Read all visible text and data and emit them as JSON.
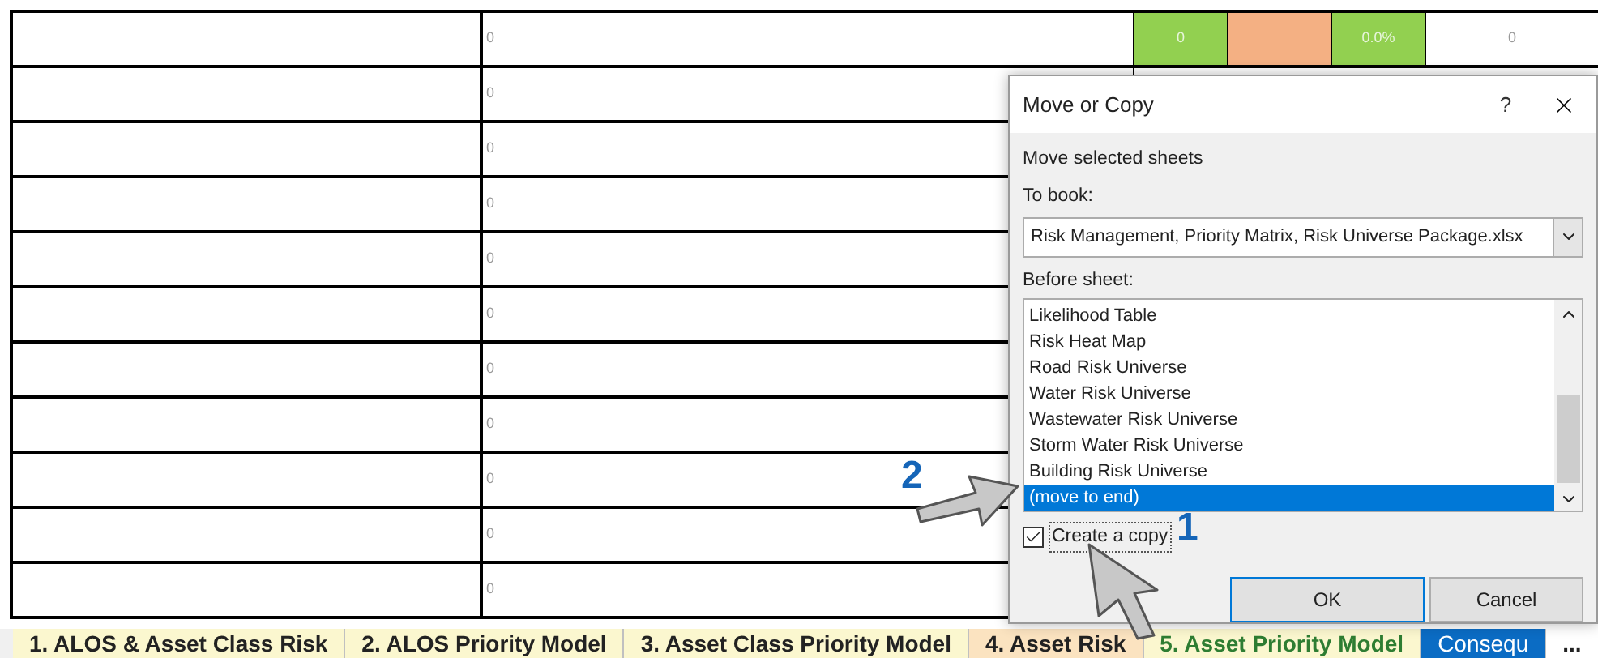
{
  "sheet": {
    "rows": [
      {
        "column_2": "0",
        "column_3": "0",
        "column_4": "",
        "column_5": "0.0%",
        "column_6": "0"
      },
      {
        "column_2": "0"
      },
      {
        "column_2": "0"
      },
      {
        "column_2": "0"
      },
      {
        "column_2": "0"
      },
      {
        "column_2": "0"
      },
      {
        "column_2": "0"
      },
      {
        "column_2": "0"
      },
      {
        "column_2": "0"
      },
      {
        "column_2": "0"
      },
      {
        "column_2": "0"
      }
    ]
  },
  "sheet_tabs": [
    {
      "label": "1. ALOS & Asset Class Risk",
      "selected": false,
      "color": "#fbf7cf"
    },
    {
      "label": "2. ALOS Priority Model",
      "selected": false,
      "color": "#fbf7cf"
    },
    {
      "label": "3. Asset Class Priority Model",
      "selected": false,
      "color": "#fbf7cf"
    },
    {
      "label": "4. Asset Risk",
      "selected": false,
      "color": "#fbe3c0"
    },
    {
      "label": "5. Asset Priority Model",
      "selected": false,
      "color": "#fbf7cf"
    },
    {
      "label": "Consequ",
      "selected": true,
      "color": "#0b6cc4"
    },
    {
      "label": "...",
      "selected": false,
      "color": "#ffffff"
    }
  ],
  "dialog": {
    "title": "Move or Copy",
    "help": "?",
    "intro": "Move selected sheets",
    "to_book_label": "To book:",
    "to_book_value": "Risk Management, Priority Matrix, Risk Universe Package.xlsx",
    "before_sheet_label": "Before sheet:",
    "sheets": [
      {
        "label": "Likelihood Table",
        "selected": false
      },
      {
        "label": "Risk Heat Map",
        "selected": false
      },
      {
        "label": "Road Risk Universe",
        "selected": false
      },
      {
        "label": "Water Risk Universe",
        "selected": false
      },
      {
        "label": "Wastewater Risk Universe",
        "selected": false
      },
      {
        "label": "Storm Water Risk Universe",
        "selected": false
      },
      {
        "label": "Building Risk Universe",
        "selected": false
      },
      {
        "label": "(move to end)",
        "selected": true
      }
    ],
    "create_copy": {
      "label": "Create a copy",
      "checked": true
    },
    "buttons": [
      "OK",
      "Cancel"
    ]
  },
  "annotations": [
    {
      "label": "2",
      "kind": "right"
    },
    {
      "label": "1",
      "kind": "up"
    }
  ]
}
